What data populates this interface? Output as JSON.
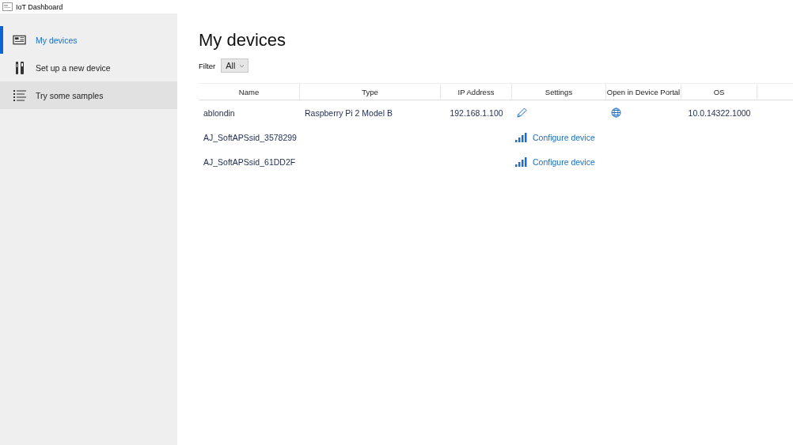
{
  "window": {
    "title": "IoT Dashboard"
  },
  "sidebar": {
    "items": [
      {
        "label": "My devices",
        "kind": "device",
        "selected": true,
        "hovered": false
      },
      {
        "label": "Set up a new device",
        "kind": "tools",
        "selected": false,
        "hovered": false
      },
      {
        "label": "Try some samples",
        "kind": "list",
        "selected": false,
        "hovered": true
      }
    ]
  },
  "page": {
    "title": "My devices",
    "filter": {
      "label": "Filter",
      "value": "All"
    }
  },
  "table": {
    "columns": [
      "Name",
      "Type",
      "IP Address",
      "Settings",
      "Open in Device Portal",
      "OS"
    ],
    "rows": [
      {
        "kind": "device",
        "name": "ablondin",
        "type": "Raspberry Pi 2 Model B",
        "ip": "192.168.1.100",
        "os": "10.0.14322.1000"
      },
      {
        "kind": "softap",
        "name": "AJ_SoftAPSsid_3578299",
        "link": "Configure device"
      },
      {
        "kind": "softap",
        "name": "AJ_SoftAPSsid_61DD2F",
        "link": "Configure device"
      }
    ]
  }
}
